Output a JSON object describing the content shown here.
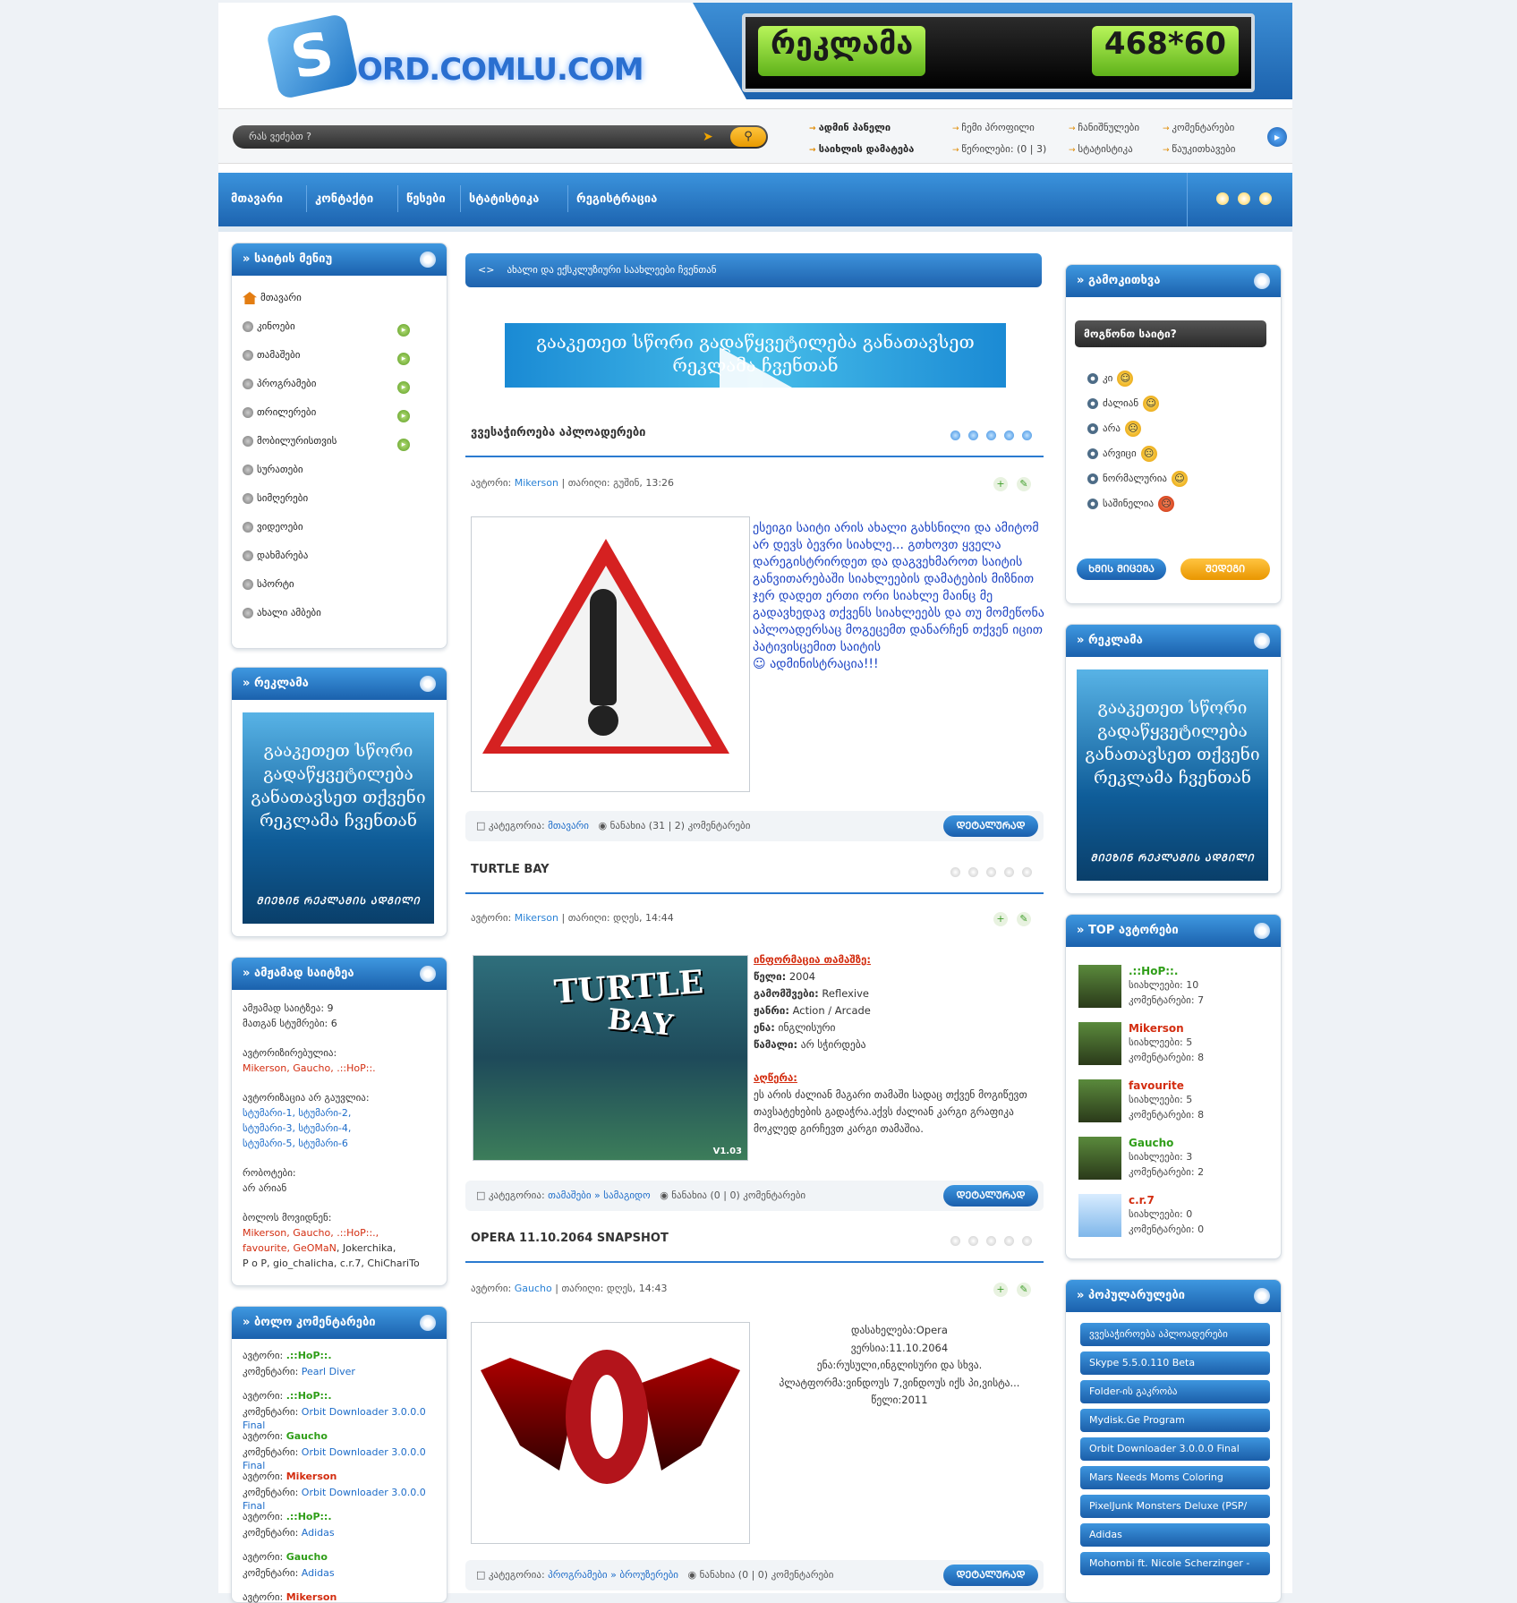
{
  "header": {
    "logo_letter": "S",
    "logo_text": "ORD.COMLU.COM",
    "ad_left": "რეკლამა",
    "ad_right": "468*60"
  },
  "search": {
    "placeholder": "რას ვეძებთ ?"
  },
  "toplinks": {
    "admin_panel": "ადმინ პანელი",
    "add_file": "საიხლის დამატება",
    "my_profile": "ჩემი პროფილი",
    "letters": "წერილები: (0 | 3)",
    "settings": "ჩანიშნულები",
    "statistics": "სტატისტიკა",
    "comments": "კომენტარები",
    "exit": "წაუკითხავები"
  },
  "nav": [
    "მთავარი",
    "კონტაქტი",
    "წესები",
    "სტატისტიკა",
    "რეგისტრაცია"
  ],
  "left": {
    "site_menu": {
      "title": "საიტის მენიუ",
      "items": [
        "მთავარი",
        "კინოები",
        "თამაშები",
        "პროგრამები",
        "თრილერები",
        "მობილურისთვის",
        "სურათები",
        "სიმღერები",
        "ვიდეოები",
        "დახმარება",
        "სპორტი",
        "ახალი ამბები"
      ]
    },
    "ad": {
      "title": "რეკლამა",
      "text": "გააკეთეთ სწორი გადაწყვეტილება განათავსეთ თქვენი რეკლამა ჩვენთან",
      "small": "ᲛᲘᲔᲖᲘᲜ ᲠᲔᲙᲚᲐᲛᲘᲡ ᲐᲓᲒᲘᲚᲘ"
    },
    "online": {
      "title": "ამჟამად საიტზეა",
      "now": "ამჟამად საიტზეა: 9",
      "guests": "მათგან სტუმრები: 6",
      "registered_label": "ავტორიზირებულია:",
      "registered": "Mikerson, Gaucho, .::HoP::.",
      "unauth_label": "ავტორიზაცია არ გაუვლია:",
      "unauth_1": "სტუმარი-1, სტუმარი-2,",
      "unauth_2": "სტუმარი-3, სტუმარი-4,",
      "unauth_3": "სტუმარი-5, სტუმარი-6",
      "bots_label": "რობოტები:",
      "bots": "არ არიან",
      "last_label": "ბოლოს მოვიდნენ:",
      "last_1a": "Mikerson, Gaucho, .::HoP::.,",
      "last_2a": "favourite",
      "last_2b": ", GeOMaN",
      "last_2c": ", Jokerchika,",
      "last_3": "P o P,  gio_chalicha, c.r.7, ChiChariTo"
    },
    "last_comments": {
      "title": "ბოლო კომენტარები",
      "author_label": "ავტორი:",
      "comment_label": "კომენტარი:",
      "rows": [
        {
          "author": ".::HoP::.",
          "comment": "Pearl Diver"
        },
        {
          "author": ".::HoP::.",
          "comment": "Orbit Downloader 3.0.0.0 Final"
        },
        {
          "author": "Gaucho",
          "comment": "Orbit Downloader 3.0.0.0 Final"
        },
        {
          "author": "Mikerson",
          "comment": "Orbit Downloader 3.0.0.0 Final"
        },
        {
          "author": ".::HoP::.",
          "comment": "Adidas"
        },
        {
          "author": "Gaucho",
          "comment": "Adidas"
        },
        {
          "author": "Mikerson",
          "comment": ""
        }
      ]
    }
  },
  "main": {
    "crumb": "ახალი და ექსკლუზიური საახლეები ჩვენთან",
    "bigad": "გააკეთეთ სწორი გადაწყვეტილება განათავსეთ რეკლამა ჩვენთან",
    "section": "ვვესაჭიროება აპლოადერები",
    "author_label": "ავტორი:",
    "date_label": "თარიღი:",
    "category_label": "კატეგორია:",
    "more_label": "ᲓᲔᲢᲐᲚᲣᲠᲐᲓ",
    "posts": [
      {
        "author": "Mikerson",
        "date": "გუშინ, 13:26",
        "text": "ესეიგი საიტი არის ახალი გახსნილი და ამიტომ არ დევს ბევრი სიახლე... გთხოვთ ყველა დარეგისტრირდეთ და დაგვეხმაროთ საიტის განვითარებაში სიახლეების დამატების მიზნით  ჯერ დადეთ ერთი ორი სიახლე მაინც მე გადავხედავ თქვენს სიახლეებს და თუ მომეწონა აპლოადერსაც მოგეცემთ დანარჩენ თქვენ იცით პატივისცემით საიტის",
        "text_end": "ადმინისტრაცია!!!",
        "category": "მთავარი",
        "views": "ნანახია (31 | 2) კომენტარები"
      },
      {
        "title": "TURTLE BAY",
        "author": "Mikerson",
        "date": "დღეს, 14:44",
        "info_head": "ინფორმაცია თამაშზე:",
        "year_k": "წელი:",
        "year_v": "2004",
        "publisher_k": "გამომშვები:",
        "publisher_v": "Reflexive",
        "genre_k": "ჟანრი:",
        "genre_v": "Action / Arcade",
        "lang_k": "ენა:",
        "lang_v": "ინგლისური",
        "crack_k": "წამალი:",
        "crack_v": "არ სჭირდება",
        "desc_head": "აღწერა:",
        "desc": "ეს არის ძალიან მაგარი თამაში სადაც თქვენ მოგიწევთ თავსატეხების გადაჭრა.აქვს ძალიან კარგი გრაფიკა მოკლედ გირჩევთ კარგი თამაშია.",
        "img_title_1": "TURTLE",
        "img_title_2": "BAY",
        "img_version": "V1.03",
        "category": "თამაშები » სამაგიდო",
        "views": "ნანახია (0 | 0) კომენტარები"
      },
      {
        "title": "OPERA 11.10.2064 SNAPSHOT",
        "author": "Gaucho",
        "date": "დღეს, 14:43",
        "l1": "დასახელება:Opera",
        "l2": "ვერსია:11.10.2064",
        "l3": "ენა:რუსული,ინგლისური და სხვა.",
        "l4": "პლატფორმა:ვინდოუს 7,ვინდოუს იქს პი,ვისტა...",
        "l5": "წელი:2011",
        "category": "პროგრამები » ბროუზერები",
        "views": "ნანახია (0 | 0) კომენტარები"
      }
    ]
  },
  "right": {
    "poll": {
      "title": "გამოკითხვა",
      "question": "მოგწონთ საიტი?",
      "options": [
        "კი",
        "ძალიან",
        "არა",
        "არვიცი",
        "ნორმალურია",
        "საშინელია"
      ],
      "vote": "ᲮᲛᲘᲡ ᲛᲘᲪᲔᲛᲐ",
      "results": "ᲨᲔᲓᲔᲒᲘ"
    },
    "ad": {
      "title": "რეკლამა",
      "text": "გააკეთეთ სწორი გადაწყვეტილება განათავსეთ თქვენი რეკლამა ჩვენთან",
      "small": "ᲛᲘᲔᲖᲘᲜ ᲠᲔᲙᲚᲐᲛᲘᲡ ᲐᲓᲒᲘᲚᲘ"
    },
    "top": {
      "title": "TOP ავტორები",
      "files_label": "სიახლეები:",
      "comments_label": "კომენტარები:",
      "users": [
        {
          "name": ".::HoP::.",
          "files": "10",
          "comments": "7"
        },
        {
          "name": "Mikerson",
          "files": "5",
          "comments": "8"
        },
        {
          "name": "favourite",
          "files": "5",
          "comments": "8"
        },
        {
          "name": "Gaucho",
          "files": "3",
          "comments": "2"
        },
        {
          "name": "c.r.7",
          "files": "0",
          "comments": "0"
        }
      ]
    },
    "popular": {
      "title": "პოპულარულები",
      "items": [
        "ვვესაჭიროება აპლოადერები",
        "Skype 5.5.0.110 Beta",
        "Folder-ის გაკრობა",
        "Mydisk.Ge Program",
        "Orbit Downloader 3.0.0.0 Final",
        "Mars Needs Moms Coloring",
        "PixelJunk Monsters Deluxe (PSP/",
        "Adidas",
        "Mohombi ft. Nicole Scherzinger -"
      ]
    }
  }
}
